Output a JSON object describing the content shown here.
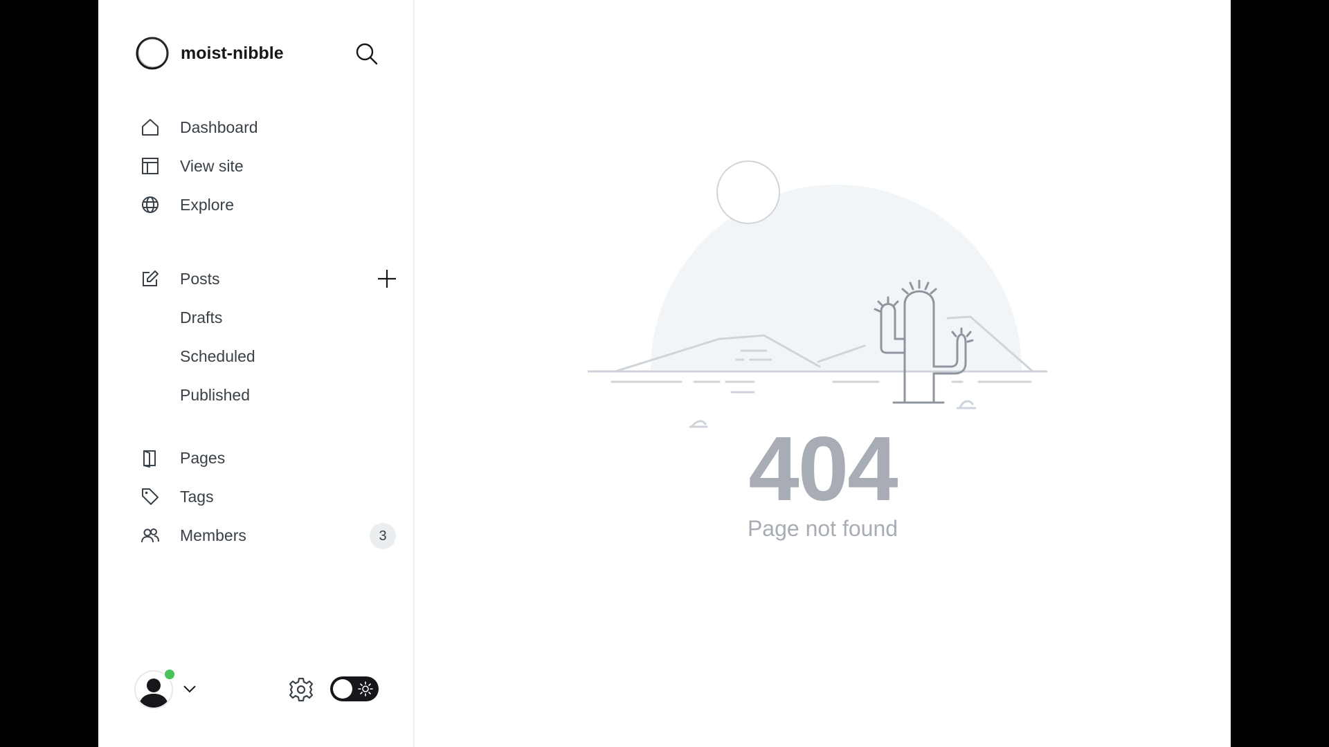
{
  "app": {
    "site_name": "moist-nibble"
  },
  "sidebar": {
    "primary": [
      {
        "label": "Dashboard",
        "icon": "home-icon"
      },
      {
        "label": "View site",
        "icon": "layout-icon"
      },
      {
        "label": "Explore",
        "icon": "globe-icon"
      }
    ],
    "posts": {
      "label": "Posts",
      "icon": "edit-icon",
      "children": [
        {
          "label": "Drafts"
        },
        {
          "label": "Scheduled"
        },
        {
          "label": "Published"
        }
      ]
    },
    "secondary": [
      {
        "label": "Pages",
        "icon": "pages-icon"
      },
      {
        "label": "Tags",
        "icon": "tag-icon"
      },
      {
        "label": "Members",
        "icon": "members-icon",
        "count": "3"
      }
    ]
  },
  "error": {
    "code": "404",
    "message": "Page not found"
  },
  "colors": {
    "status_online": "#4ac25a",
    "muted_text": "#a8adb5",
    "illustration_bg": "#f2f5f8"
  }
}
